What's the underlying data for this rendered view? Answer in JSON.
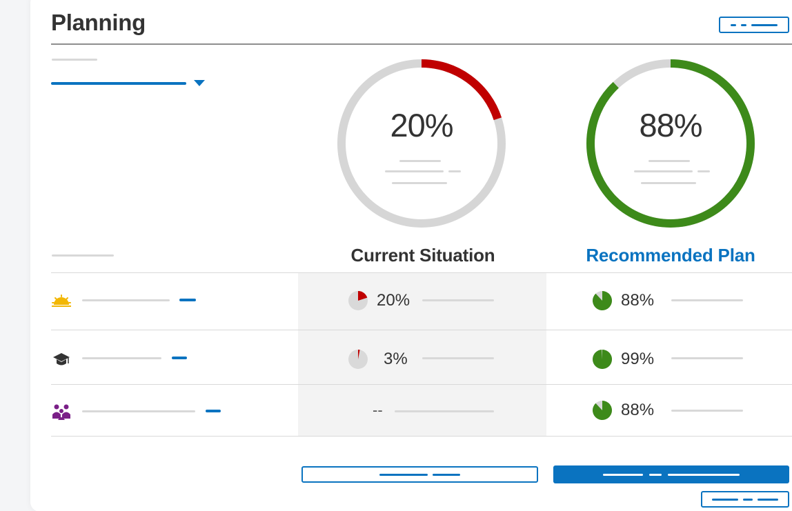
{
  "header": {
    "title": "Planning"
  },
  "gauges": {
    "current": {
      "label": "20%",
      "value": 0.2,
      "color": "#c00000"
    },
    "recommended": {
      "label": "88%",
      "value": 0.88,
      "color": "#3d8a1a"
    }
  },
  "columns": {
    "current": "Current Situation",
    "recommended": "Recommended Plan"
  },
  "rows": [
    {
      "icon": "sunrise-icon",
      "current_label": "20%",
      "current_value": 0.2,
      "recommended_label": "88%",
      "recommended_value": 0.88
    },
    {
      "icon": "graduation-cap-icon",
      "current_label": "3%",
      "current_value": 0.03,
      "recommended_label": "99%",
      "recommended_value": 0.99
    },
    {
      "icon": "family-icon",
      "current_label": "--",
      "current_value": null,
      "recommended_label": "88%",
      "recommended_value": 0.88
    }
  ],
  "colors": {
    "accent": "#0a73c0",
    "danger": "#c00000",
    "success": "#3d8a1a",
    "track": "#d6d6d6"
  }
}
